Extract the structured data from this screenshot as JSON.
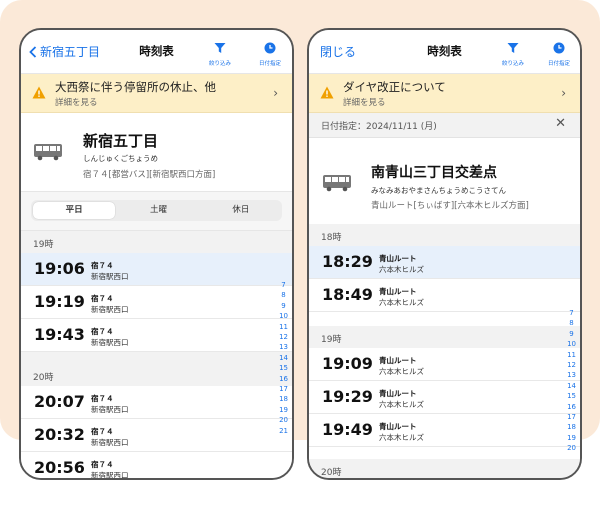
{
  "left": {
    "nav": {
      "back_label": "新宿五丁目",
      "title": "時刻表",
      "filter_label": "絞り込み",
      "date_label": "日付指定"
    },
    "notice": {
      "title": "大西祭に伴う停留所の休止、他",
      "sub": "詳細を見る"
    },
    "stop": {
      "name": "新宿五丁目",
      "kana": "しんじゅくごちょうめ",
      "route": "宿７４[都営バス][新宿駅西口方面]"
    },
    "tabs": [
      "平日",
      "土曜",
      "休日"
    ],
    "hours": [
      {
        "label": "19時",
        "rows": [
          {
            "time": "19:06",
            "route": "宿７４",
            "dest": "新宿駅西口"
          },
          {
            "time": "19:19",
            "route": "宿７４",
            "dest": "新宿駅西口"
          },
          {
            "time": "19:43",
            "route": "宿７４",
            "dest": "新宿駅西口"
          }
        ]
      },
      {
        "label": "20時",
        "rows": [
          {
            "time": "20:07",
            "route": "宿７４",
            "dest": "新宿駅西口"
          },
          {
            "time": "20:32",
            "route": "宿７４",
            "dest": "新宿駅西口"
          },
          {
            "time": "20:56",
            "route": "宿７４",
            "dest": "新宿駅西口"
          }
        ]
      }
    ],
    "index": [
      "7",
      "8",
      "9",
      "10",
      "11",
      "12",
      "13",
      "14",
      "15",
      "16",
      "17",
      "18",
      "19",
      "20",
      "21"
    ]
  },
  "right": {
    "nav": {
      "close_label": "閉じる",
      "title": "時刻表",
      "filter_label": "絞り込み",
      "date_label": "日付指定"
    },
    "notice": {
      "title": "ダイヤ改正について",
      "sub": "詳細を見る"
    },
    "date_filter": "日付指定：2024/11/11 (月)",
    "stop": {
      "name": "南青山三丁目交差点",
      "kana": "みなみあおやまさんちょうめこうさてん",
      "route": "青山ルート[ちぃばす][六本木ヒルズ方面]"
    },
    "hours": [
      {
        "label": "18時",
        "rows": [
          {
            "time": "18:29",
            "route": "青山ルート",
            "dest": "六本木ヒルズ"
          },
          {
            "time": "18:49",
            "route": "青山ルート",
            "dest": "六本木ヒルズ"
          }
        ]
      },
      {
        "label": "19時",
        "rows": [
          {
            "time": "19:09",
            "route": "青山ルート",
            "dest": "六本木ヒルズ"
          },
          {
            "time": "19:29",
            "route": "青山ルート",
            "dest": "六本木ヒルズ"
          },
          {
            "time": "19:49",
            "route": "青山ルート",
            "dest": "六本木ヒルズ"
          }
        ]
      },
      {
        "label": "20時",
        "rows": []
      }
    ],
    "index": [
      "7",
      "8",
      "9",
      "10",
      "11",
      "12",
      "13",
      "14",
      "15",
      "16",
      "17",
      "18",
      "19",
      "20"
    ]
  },
  "colors": {
    "accent": "#1a73e8",
    "warning": "#f0a000",
    "notice_bg": "#fdefc7",
    "highlight": "#e7f0fb",
    "background": "#fbe9d8"
  }
}
